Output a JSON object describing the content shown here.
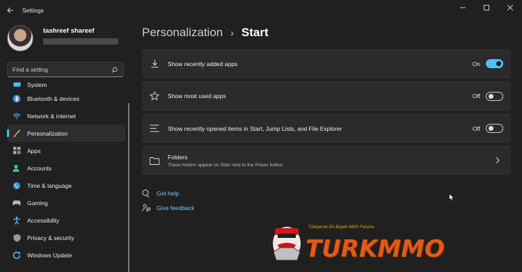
{
  "window": {
    "title": "Settings",
    "controls": {
      "minimize": "—",
      "maximize": "☐",
      "close": "✕"
    }
  },
  "profile": {
    "name": "tashreef shareef"
  },
  "search": {
    "placeholder": "Find a setting"
  },
  "sidebar": {
    "items": [
      {
        "label": "System",
        "icon": "system-icon",
        "color": "#4cc2ff"
      },
      {
        "label": "Bluetooth & devices",
        "icon": "bluetooth-icon",
        "color": "#4cc2ff"
      },
      {
        "label": "Network & internet",
        "icon": "wifi-icon",
        "color": "#4cc2ff"
      },
      {
        "label": "Personalization",
        "icon": "brush-icon",
        "color": "#e8a050",
        "active": true
      },
      {
        "label": "Apps",
        "icon": "apps-icon",
        "color": "#a0a0a0"
      },
      {
        "label": "Accounts",
        "icon": "accounts-icon",
        "color": "#3fc78a"
      },
      {
        "label": "Time & language",
        "icon": "globe-icon",
        "color": "#4cc2ff"
      },
      {
        "label": "Gaming",
        "icon": "gamepad-icon",
        "color": "#b0b0b0"
      },
      {
        "label": "Accessibility",
        "icon": "accessibility-icon",
        "color": "#4cc2ff"
      },
      {
        "label": "Privacy & security",
        "icon": "shield-icon",
        "color": "#a8a8a8"
      },
      {
        "label": "Windows Update",
        "icon": "update-icon",
        "color": "#4cc2ff"
      }
    ]
  },
  "breadcrumb": {
    "parent": "Personalization",
    "separator": "›",
    "current": "Start"
  },
  "settings": [
    {
      "label": "Show recently added apps",
      "icon": "download-icon",
      "state": "On",
      "on": true
    },
    {
      "label": "Show most used apps",
      "icon": "star-icon",
      "state": "Off",
      "on": false
    },
    {
      "label": "Show recently opened items in Start, Jump Lists, and File Explorer",
      "icon": "list-icon",
      "state": "Off",
      "on": false
    }
  ],
  "folders": {
    "title": "Folders",
    "description": "These folders appear on Start next to the Power button"
  },
  "links": {
    "help": "Get help",
    "feedback": "Give feedback"
  },
  "watermark": {
    "brand": "TURKMMO",
    "tagline": "Türkiye'nin En Büyük MMO Forumu"
  },
  "colors": {
    "accent": "#4cc2ff",
    "background": "#202020",
    "card": "#2b2b2b",
    "link": "#78c9ff"
  }
}
